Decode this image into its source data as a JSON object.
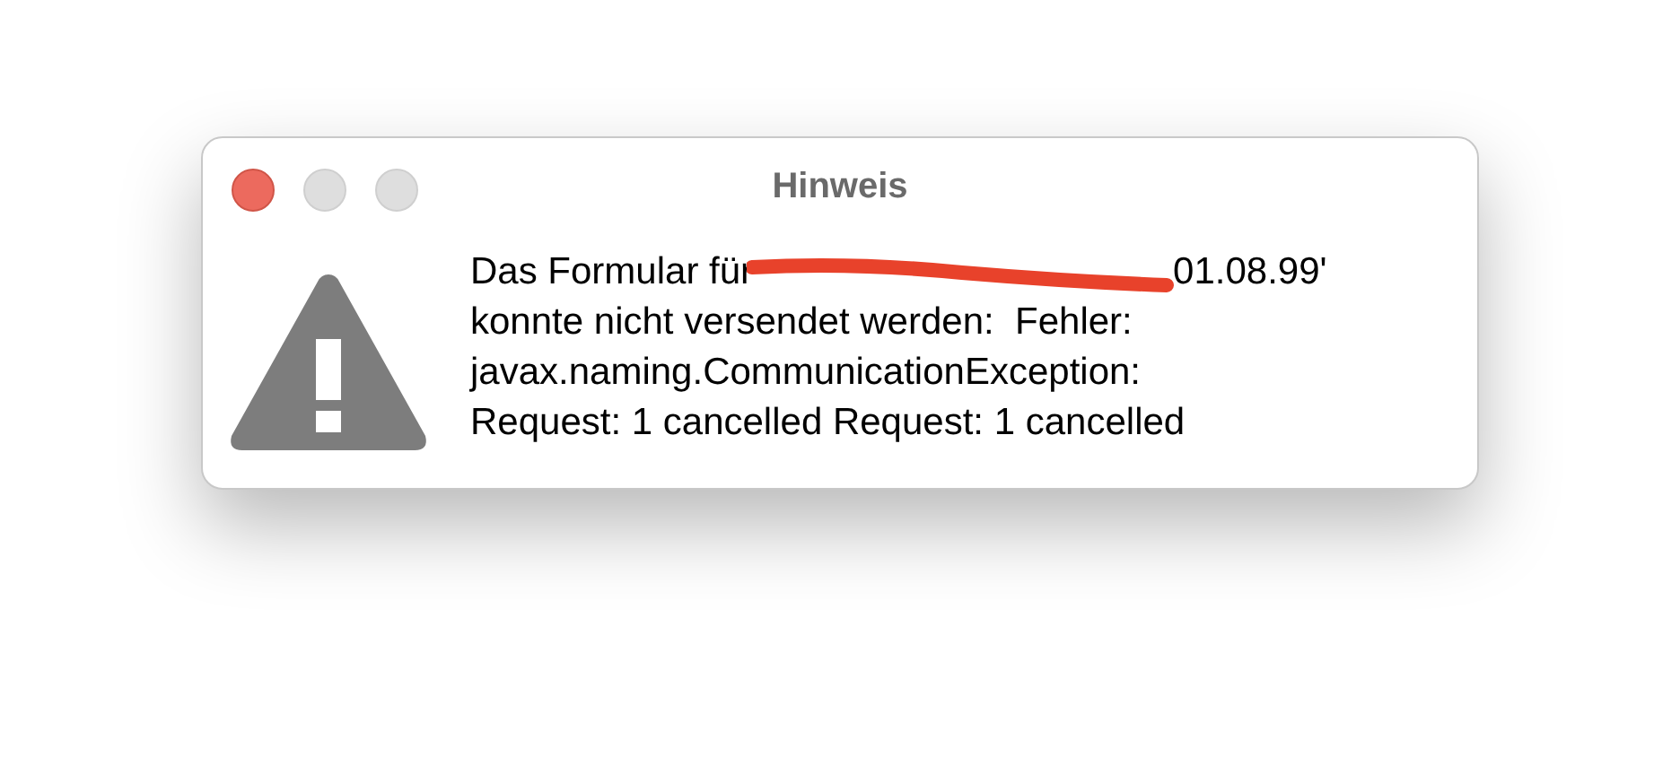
{
  "window": {
    "title": "Hinweis"
  },
  "message": {
    "before_redaction": "Das Formular für",
    "after_redaction": "01.08.99'",
    "lines": [
      "konnte nicht versendet werden:  Fehler:",
      "javax.naming.CommunicationException:",
      "Request: 1 cancelled Request: 1 cancelled"
    ]
  }
}
